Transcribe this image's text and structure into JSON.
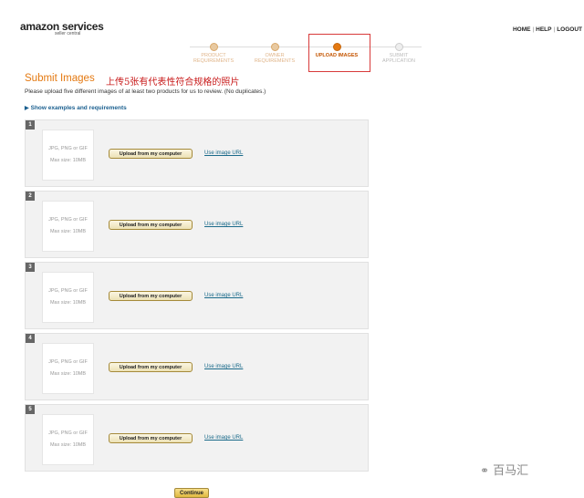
{
  "header": {
    "brand": "amazon services",
    "sub": "seller central",
    "nav": [
      "HOME",
      "HELP",
      "LOGOUT"
    ]
  },
  "steps": [
    {
      "num": "1",
      "label1": "PRODUCT",
      "label2": "REQUIREMENTS",
      "state": "done"
    },
    {
      "num": "2",
      "label1": "OWNER",
      "label2": "REQUIREMENTS",
      "state": "done"
    },
    {
      "num": "3",
      "label1": "UPLOAD IMAGES",
      "label2": "",
      "state": "active"
    },
    {
      "num": "4",
      "label1": "SUBMIT",
      "label2": "APPLICATION",
      "state": "future"
    }
  ],
  "page": {
    "title": "Submit Images",
    "annotation": "上传5张有代表性符合规格的照片",
    "description": "Please upload five different images of at least two products for us to review. (No duplicates.)",
    "show_examples": "Show examples and requirements"
  },
  "slots": [
    {
      "num": "1",
      "formats": "JPG, PNG or GIF",
      "max": "Max size: 10MB",
      "upload": "Upload from my computer",
      "url": "Use image URL"
    },
    {
      "num": "2",
      "formats": "JPG, PNG or GIF",
      "max": "Max size: 10MB",
      "upload": "Upload from my computer",
      "url": "Use image URL"
    },
    {
      "num": "3",
      "formats": "JPG, PNG or GIF",
      "max": "Max size: 10MB",
      "upload": "Upload from my computer",
      "url": "Use image URL"
    },
    {
      "num": "4",
      "formats": "JPG, PNG or GIF",
      "max": "Max size: 10MB",
      "upload": "Upload from my computer",
      "url": "Use image URL"
    },
    {
      "num": "5",
      "formats": "JPG, PNG or GIF",
      "max": "Max size: 10MB",
      "upload": "Upload from my computer",
      "url": "Use image URL"
    }
  ],
  "continue_label": "Continue",
  "watermark": "百马汇",
  "colors": {
    "accent": "#e47911",
    "link": "#1a5f8f",
    "annotation": "#c81a1a"
  }
}
